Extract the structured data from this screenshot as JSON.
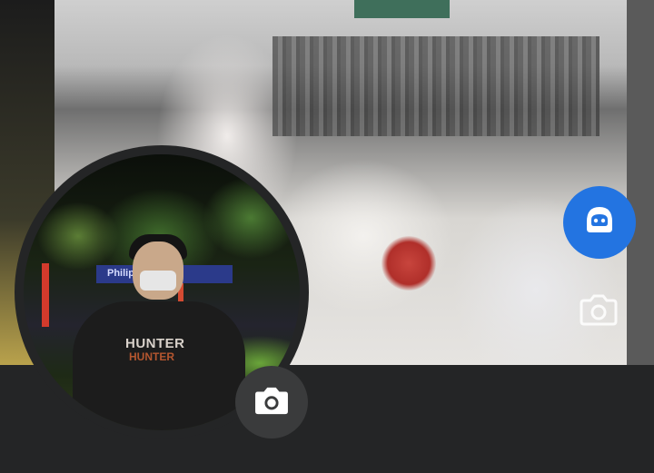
{
  "profile": {
    "hoodie_text_top": "HUNTER",
    "hoodie_text_bottom": "HUNTER",
    "store_sign": "Philippine"
  },
  "icons": {
    "profile_camera": "camera-icon",
    "cover_camera": "camera-icon",
    "avatar": "avatar-icon"
  },
  "colors": {
    "background": "#242526",
    "accent": "#2374e1",
    "button_bg": "#3a3b3c"
  }
}
